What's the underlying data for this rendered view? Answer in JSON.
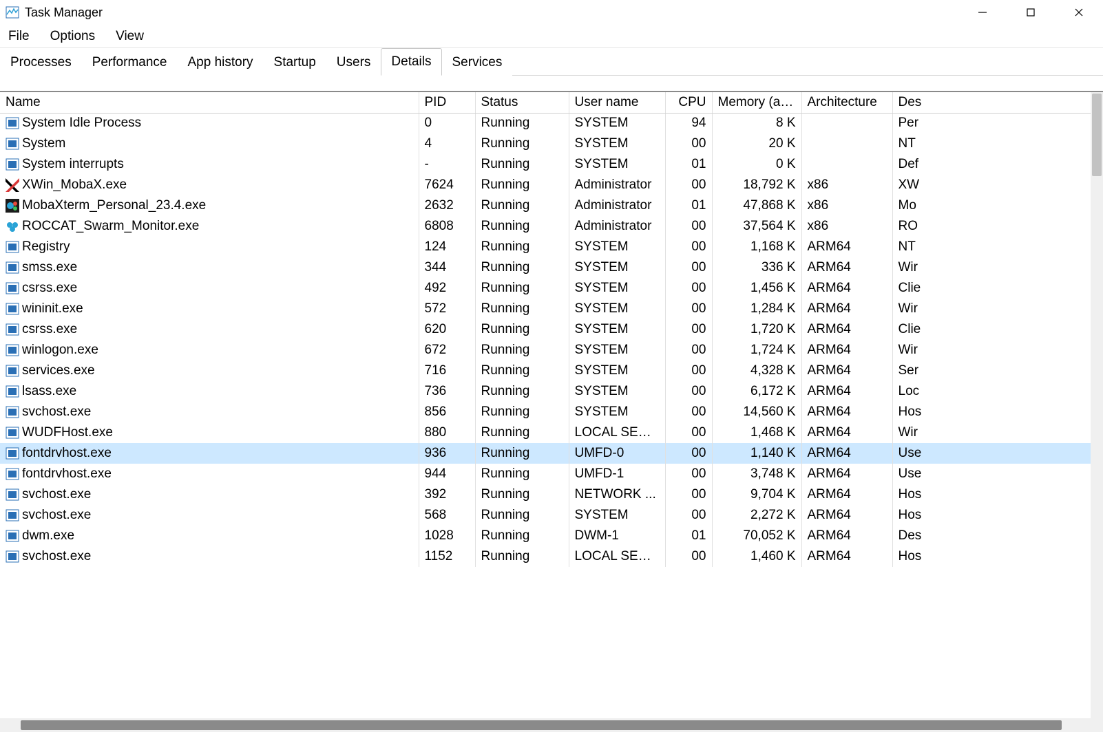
{
  "window": {
    "title": "Task Manager",
    "min": "—",
    "max": "☐",
    "close": "✕"
  },
  "menu": {
    "file": "File",
    "options": "Options",
    "view": "View"
  },
  "tabs": {
    "processes": "Processes",
    "performance": "Performance",
    "app_history": "App history",
    "startup": "Startup",
    "users": "Users",
    "details": "Details",
    "services": "Services"
  },
  "columns": {
    "name": "Name",
    "pid": "PID",
    "status": "Status",
    "user": "User name",
    "cpu": "CPU",
    "memory": "Memory (ac...",
    "arch": "Architecture",
    "desc": "Des"
  },
  "selected_index": 16,
  "rows": [
    {
      "icon": "generic",
      "name": "System Idle Process",
      "pid": "0",
      "status": "Running",
      "user": "SYSTEM",
      "cpu": "94",
      "mem": "8 K",
      "arch": "",
      "desc": "Per"
    },
    {
      "icon": "generic",
      "name": "System",
      "pid": "4",
      "status": "Running",
      "user": "SYSTEM",
      "cpu": "00",
      "mem": "20 K",
      "arch": "",
      "desc": "NT"
    },
    {
      "icon": "generic",
      "name": "System interrupts",
      "pid": "-",
      "status": "Running",
      "user": "SYSTEM",
      "cpu": "01",
      "mem": "0 K",
      "arch": "",
      "desc": "Def"
    },
    {
      "icon": "xwin",
      "name": "XWin_MobaX.exe",
      "pid": "7624",
      "status": "Running",
      "user": "Administrator",
      "cpu": "00",
      "mem": "18,792 K",
      "arch": "x86",
      "desc": "XW"
    },
    {
      "icon": "moba",
      "name": "MobaXterm_Personal_23.4.exe",
      "pid": "2632",
      "status": "Running",
      "user": "Administrator",
      "cpu": "01",
      "mem": "47,868 K",
      "arch": "x86",
      "desc": "Mo"
    },
    {
      "icon": "roccat",
      "name": "ROCCAT_Swarm_Monitor.exe",
      "pid": "6808",
      "status": "Running",
      "user": "Administrator",
      "cpu": "00",
      "mem": "37,564 K",
      "arch": "x86",
      "desc": "RO"
    },
    {
      "icon": "generic",
      "name": "Registry",
      "pid": "124",
      "status": "Running",
      "user": "SYSTEM",
      "cpu": "00",
      "mem": "1,168 K",
      "arch": "ARM64",
      "desc": "NT"
    },
    {
      "icon": "generic",
      "name": "smss.exe",
      "pid": "344",
      "status": "Running",
      "user": "SYSTEM",
      "cpu": "00",
      "mem": "336 K",
      "arch": "ARM64",
      "desc": "Wir"
    },
    {
      "icon": "generic",
      "name": "csrss.exe",
      "pid": "492",
      "status": "Running",
      "user": "SYSTEM",
      "cpu": "00",
      "mem": "1,456 K",
      "arch": "ARM64",
      "desc": "Clie"
    },
    {
      "icon": "generic",
      "name": "wininit.exe",
      "pid": "572",
      "status": "Running",
      "user": "SYSTEM",
      "cpu": "00",
      "mem": "1,284 K",
      "arch": "ARM64",
      "desc": "Wir"
    },
    {
      "icon": "generic",
      "name": "csrss.exe",
      "pid": "620",
      "status": "Running",
      "user": "SYSTEM",
      "cpu": "00",
      "mem": "1,720 K",
      "arch": "ARM64",
      "desc": "Clie"
    },
    {
      "icon": "generic",
      "name": "winlogon.exe",
      "pid": "672",
      "status": "Running",
      "user": "SYSTEM",
      "cpu": "00",
      "mem": "1,724 K",
      "arch": "ARM64",
      "desc": "Wir"
    },
    {
      "icon": "generic",
      "name": "services.exe",
      "pid": "716",
      "status": "Running",
      "user": "SYSTEM",
      "cpu": "00",
      "mem": "4,328 K",
      "arch": "ARM64",
      "desc": "Ser"
    },
    {
      "icon": "generic",
      "name": "lsass.exe",
      "pid": "736",
      "status": "Running",
      "user": "SYSTEM",
      "cpu": "00",
      "mem": "6,172 K",
      "arch": "ARM64",
      "desc": "Loc"
    },
    {
      "icon": "generic",
      "name": "svchost.exe",
      "pid": "856",
      "status": "Running",
      "user": "SYSTEM",
      "cpu": "00",
      "mem": "14,560 K",
      "arch": "ARM64",
      "desc": "Hos"
    },
    {
      "icon": "generic",
      "name": "WUDFHost.exe",
      "pid": "880",
      "status": "Running",
      "user": "LOCAL SERV...",
      "cpu": "00",
      "mem": "1,468 K",
      "arch": "ARM64",
      "desc": "Wir"
    },
    {
      "icon": "generic",
      "name": "fontdrvhost.exe",
      "pid": "936",
      "status": "Running",
      "user": "UMFD-0",
      "cpu": "00",
      "mem": "1,140 K",
      "arch": "ARM64",
      "desc": "Use"
    },
    {
      "icon": "generic",
      "name": "fontdrvhost.exe",
      "pid": "944",
      "status": "Running",
      "user": "UMFD-1",
      "cpu": "00",
      "mem": "3,748 K",
      "arch": "ARM64",
      "desc": "Use"
    },
    {
      "icon": "generic",
      "name": "svchost.exe",
      "pid": "392",
      "status": "Running",
      "user": "NETWORK ...",
      "cpu": "00",
      "mem": "9,704 K",
      "arch": "ARM64",
      "desc": "Hos"
    },
    {
      "icon": "generic",
      "name": "svchost.exe",
      "pid": "568",
      "status": "Running",
      "user": "SYSTEM",
      "cpu": "00",
      "mem": "2,272 K",
      "arch": "ARM64",
      "desc": "Hos"
    },
    {
      "icon": "generic",
      "name": "dwm.exe",
      "pid": "1028",
      "status": "Running",
      "user": "DWM-1",
      "cpu": "01",
      "mem": "70,052 K",
      "arch": "ARM64",
      "desc": "Des"
    },
    {
      "icon": "generic",
      "name": "svchost.exe",
      "pid": "1152",
      "status": "Running",
      "user": "LOCAL SERV...",
      "cpu": "00",
      "mem": "1,460 K",
      "arch": "ARM64",
      "desc": "Hos"
    }
  ]
}
